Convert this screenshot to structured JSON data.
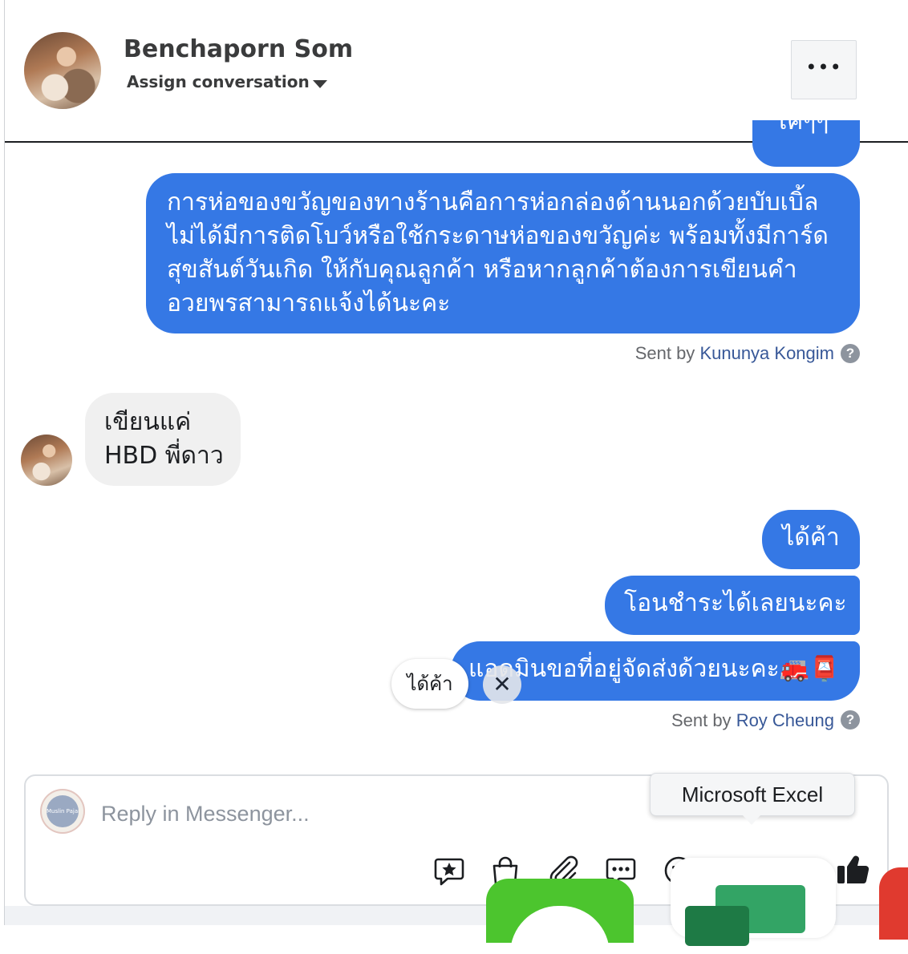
{
  "header": {
    "contact_name": "Benchaporn Som",
    "assign_label": "Assign conversation",
    "more_label": "•••"
  },
  "messages": {
    "partial_top": "ไค่ๆๆ",
    "m1_lines": [
      "การห่อของขวัญของทางร้านคือการห่อกล่องด้านนอกด้วยบับเบิ้ล",
      "ไม่ได้มีการติดโบว์หรือใช้กระดาษห่อของขวัญค่ะ พร้อมทั้งมีการ์ด",
      "สุขสันต์วันเกิด ให้กับคุณลูกค้า หรือหากลูกค้าต้องการเขียนคำ",
      "อวยพรสามารถแจ้งได้นะคะ"
    ],
    "m1_sent_prefix": "Sent by",
    "m1_sent_by": "Kununya Kongim",
    "in_lines": [
      "เขียนแค่",
      "HBD พี่ดาว"
    ],
    "m2": "ได้ค้า",
    "m3": "โอนชำระได้เลยนะคะ",
    "m4": "แอดมินขอที่อยู่จัดส่งด้วยนะคะ🚒📮",
    "m4_sent_prefix": "Sent by",
    "m4_sent_by": "Roy Cheung",
    "help_glyph": "?"
  },
  "quick_reply": {
    "label": "ได้ค้า",
    "close_glyph": "✕"
  },
  "composer": {
    "placeholder": "Reply in Messenger...",
    "page_avatar_text": "Muslin Pajamas",
    "toolbar_icons": [
      "saved-reply-icon",
      "shopping-bag-icon",
      "attachment-icon",
      "chat-bubble-icon",
      "emoji-icon",
      "gif-icon",
      "more-icon",
      "like-icon"
    ]
  },
  "tooltip": {
    "label": "Microsoft Excel"
  },
  "colors": {
    "outgoing_bubble": "#3578e5",
    "incoming_bubble": "#f0f0f0",
    "sender_link": "#385898"
  }
}
